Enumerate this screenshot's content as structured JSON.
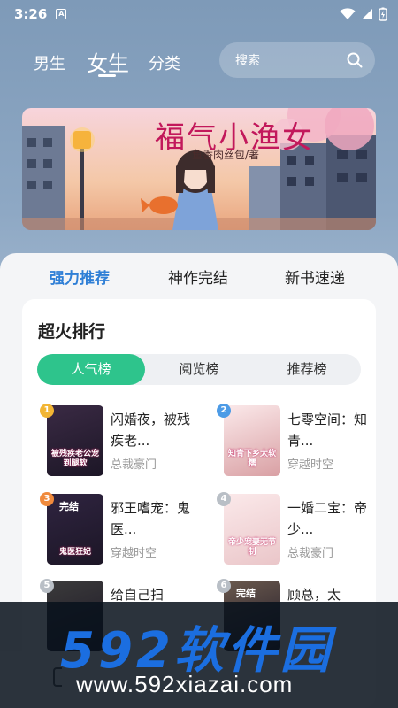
{
  "status_bar": {
    "time": "3:26",
    "notif_letter": "A"
  },
  "header": {
    "tabs": [
      "男生",
      "女生",
      "分类"
    ],
    "active_tab": "女生",
    "search_placeholder": "搜索"
  },
  "banner": {
    "title": "福气小渔女",
    "author": "鱼香肉丝包/著"
  },
  "section_tabs": [
    "强力推荐",
    "神作完结",
    "新书速递"
  ],
  "ranking": {
    "title": "超火排行",
    "options": [
      "人气榜",
      "阅览榜",
      "推荐榜"
    ],
    "active_option": "人气榜",
    "books": [
      {
        "rank": "1",
        "title": "闪婚夜，被残疾老...",
        "tag": "总裁豪门",
        "cover_text": "被残疾老公宠到腿软",
        "cover_color": "#3a2a44",
        "badge_color": "#f2b534"
      },
      {
        "rank": "2",
        "title": "七零空间：知青...",
        "tag": "穿越时空",
        "cover_text": "知青下乡太软糯",
        "cover_color": "#d9a0a4",
        "badge_color": "#4d9be6"
      },
      {
        "rank": "3",
        "title": "邪王嗜宠：鬼医...",
        "tag": "穿越时空",
        "cover_text": "鬼医狂妃",
        "cover_color": "#2f2440",
        "badge_color": "#f08a3c",
        "corner": "完结"
      },
      {
        "rank": "4",
        "title": "一婚二宝：帝少...",
        "tag": "总裁豪门",
        "cover_text": "帝少宠妻无节制",
        "cover_color": "#eac6c9",
        "badge_color": "#b9bfc6"
      },
      {
        "rank": "5",
        "title": "给自己扫",
        "tag": "",
        "cover_text": "",
        "cover_color": "#3b3b3b",
        "badge_color": "#b9bfc6"
      },
      {
        "rank": "6",
        "title": "顾总，太",
        "tag": "",
        "cover_text": "",
        "cover_color": "#6b5a4e",
        "badge_color": "#b9bfc6",
        "corner": "完结"
      }
    ]
  },
  "watermark": {
    "big": "592软件园",
    "small": "www.592xiazai.com"
  }
}
